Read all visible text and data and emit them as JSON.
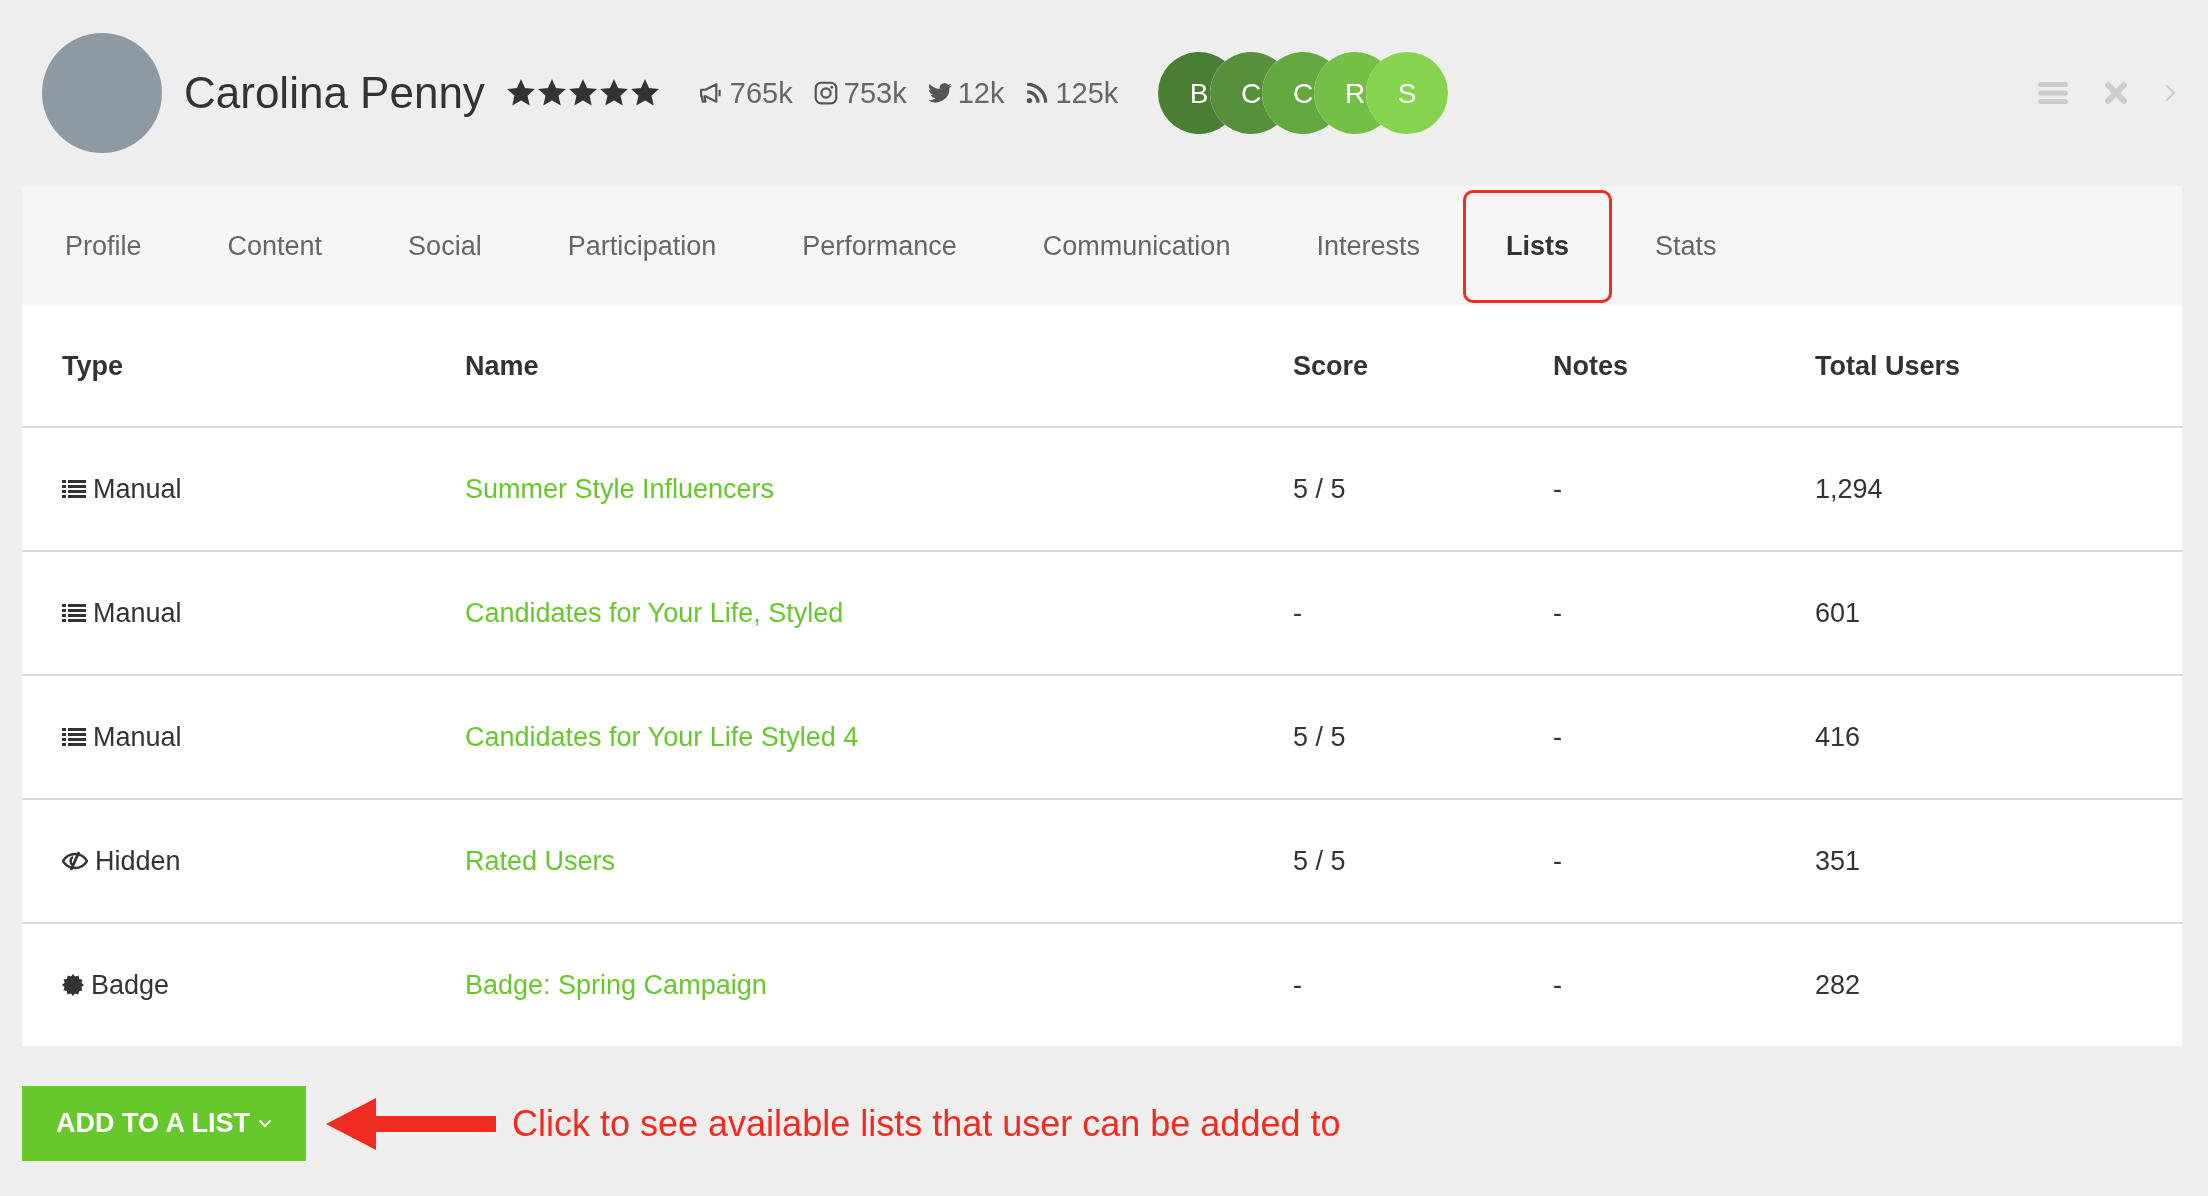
{
  "profile": {
    "name": "Carolina Penny",
    "stars": 5,
    "stats": [
      {
        "kind": "megaphone",
        "value": "765k"
      },
      {
        "kind": "instagram",
        "value": "753k"
      },
      {
        "kind": "twitter",
        "value": "12k"
      },
      {
        "kind": "rss",
        "value": "125k"
      }
    ],
    "circles": [
      {
        "letter": "B",
        "color": "#4b7e35"
      },
      {
        "letter": "C",
        "color": "#56903b"
      },
      {
        "letter": "C",
        "color": "#63a83f"
      },
      {
        "letter": "R",
        "color": "#74bf45"
      },
      {
        "letter": "S",
        "color": "#86d34f"
      }
    ]
  },
  "tabs": [
    {
      "label": "Profile",
      "selected": false,
      "highlighted": false
    },
    {
      "label": "Content",
      "selected": false,
      "highlighted": false
    },
    {
      "label": "Social",
      "selected": false,
      "highlighted": false
    },
    {
      "label": "Participation",
      "selected": false,
      "highlighted": false
    },
    {
      "label": "Performance",
      "selected": false,
      "highlighted": false
    },
    {
      "label": "Communication",
      "selected": false,
      "highlighted": false
    },
    {
      "label": "Interests",
      "selected": false,
      "highlighted": false
    },
    {
      "label": "Lists",
      "selected": true,
      "highlighted": true
    },
    {
      "label": "Stats",
      "selected": false,
      "highlighted": false
    }
  ],
  "table": {
    "columns": [
      "Type",
      "Name",
      "Score",
      "Notes",
      "Total Users"
    ],
    "rows": [
      {
        "kind": "manual",
        "type": "Manual",
        "name": "Summer Style Influencers",
        "score": "5 / 5",
        "notes": "-",
        "total": "1,294"
      },
      {
        "kind": "manual",
        "type": "Manual",
        "name": "Candidates for Your Life, Styled",
        "score": "-",
        "notes": "-",
        "total": "601"
      },
      {
        "kind": "manual",
        "type": "Manual",
        "name": "Candidates for Your Life Styled 4",
        "score": "5 / 5",
        "notes": "-",
        "total": "416"
      },
      {
        "kind": "hidden",
        "type": "Hidden",
        "name": "Rated Users",
        "score": "5 / 5",
        "notes": "-",
        "total": "351"
      },
      {
        "kind": "badge",
        "type": "Badge",
        "name": "Badge: Spring Campaign",
        "score": "-",
        "notes": "-",
        "total": "282"
      }
    ]
  },
  "add_button": "ADD TO A LIST",
  "annotation": "Click to see available lists that user can be added to"
}
